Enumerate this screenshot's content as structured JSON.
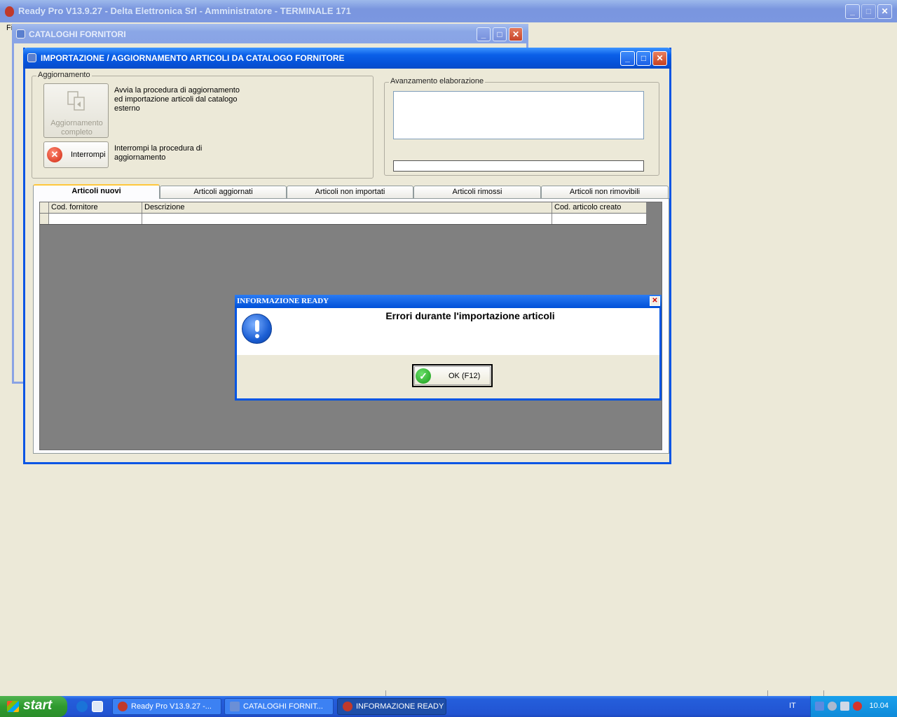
{
  "app": {
    "title": "Ready Pro V13.9.27 - Delta Elettronica Srl - Amministratore - TERMINALE 171",
    "menu_first": "Fi"
  },
  "catalog_window": {
    "title": "CATALOGHI FORNITORI"
  },
  "import_window": {
    "title": "IMPORTAZIONE / AGGIORNAMENTO ARTICOLI DA CATALOGO FORNITORE",
    "group_update": "Aggiornamento",
    "full_update_button": "Aggiornamento completo",
    "full_update_desc": "Avvia la procedura di aggiornamento ed importazione articoli dal catalogo esterno",
    "stop_button": "Interrompi",
    "stop_desc": "Interrompi la procedura di aggiornamento",
    "group_progress": "Avanzamento elaborazione",
    "progress_text": "",
    "progress_value": 0,
    "tabs": [
      "Articoli nuovi",
      "Articoli aggiornati",
      "Articoli non importati",
      "Articoli rimossi",
      "Articoli non rimovibili"
    ],
    "active_tab": 0,
    "columns": [
      "Cod. fornitore",
      "Descrizione",
      "Cod. articolo creato"
    ]
  },
  "dialog": {
    "title": "INFORMAZIONE READY",
    "message": "Errori durante l'importazione articoli",
    "ok_button": "OK (F12)",
    "icon": "exclamation-icon"
  },
  "taskbar": {
    "start_label": "start",
    "tasks": [
      {
        "label": "Ready Pro V13.9.27 -..."
      },
      {
        "label": "CATALOGHI FORNIT..."
      },
      {
        "label": "INFORMAZIONE READY"
      }
    ],
    "language": "IT",
    "clock": "10.04"
  },
  "colors": {
    "active_title": "#0a55e4",
    "inactive_title": "#7b97e0",
    "window_bg": "#ece9d8",
    "grid_bg": "#808080",
    "taskbar": "#245edb",
    "start": "#2f9a2f"
  }
}
